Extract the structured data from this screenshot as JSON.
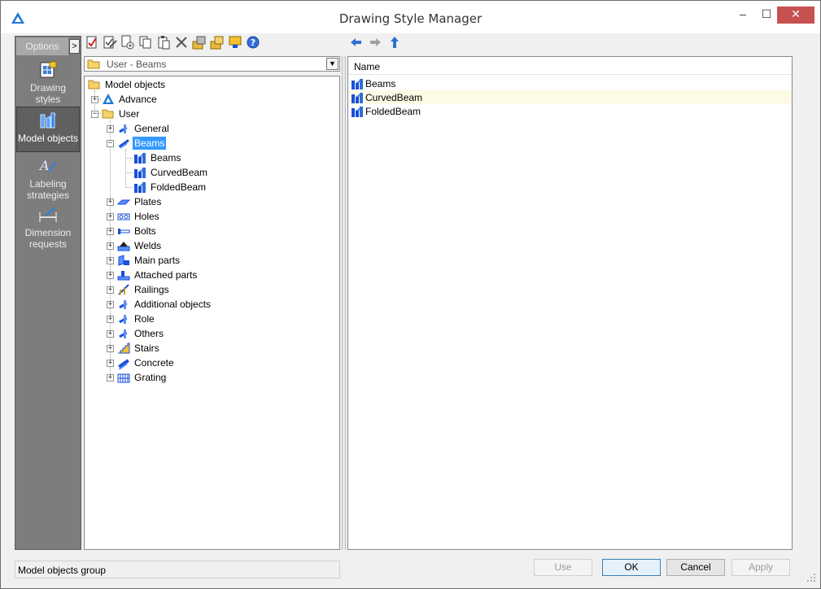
{
  "window": {
    "title": "Drawing Style Manager",
    "min_glyph": "–",
    "max_glyph": "☐",
    "close_glyph": "✕"
  },
  "sidebar": {
    "options_label": "Options",
    "collapse_glyph": ">",
    "items": [
      {
        "label": "Drawing styles",
        "icon": "drawing-styles-icon"
      },
      {
        "label": "Model objects",
        "icon": "model-objects-icon",
        "active": true
      },
      {
        "label": "Labeling strategies",
        "icon": "labeling-strategies-icon"
      },
      {
        "label": "Dimension requests",
        "icon": "dimension-requests-icon"
      }
    ]
  },
  "toolbar": {
    "icons": [
      "new-icon",
      "edit-icon",
      "new-from-icon",
      "copy-icon",
      "paste-icon",
      "delete-icon",
      "import-icon",
      "export-icon",
      "preview-icon",
      "help-icon"
    ]
  },
  "nav": {
    "icons": [
      "back-arrow-icon",
      "forward-arrow-icon",
      "up-arrow-icon"
    ]
  },
  "combo": {
    "value": "User - Beams"
  },
  "tree": {
    "root": "Model objects",
    "advance": "Advance",
    "user": "User",
    "user_children": [
      {
        "label": "General",
        "expanded": false
      },
      {
        "label": "Beams",
        "expanded": true,
        "selected": true
      },
      {
        "label": "Plates",
        "expanded": false
      },
      {
        "label": "Holes",
        "expanded": false
      },
      {
        "label": "Bolts",
        "expanded": false
      },
      {
        "label": "Welds",
        "expanded": false
      },
      {
        "label": "Main parts",
        "expanded": false
      },
      {
        "label": "Attached parts",
        "expanded": false
      },
      {
        "label": "Railings",
        "expanded": false
      },
      {
        "label": "Additional objects",
        "expanded": false
      },
      {
        "label": "Role",
        "expanded": false
      },
      {
        "label": "Others",
        "expanded": false
      },
      {
        "label": "Stairs",
        "expanded": false
      },
      {
        "label": "Concrete",
        "expanded": false
      },
      {
        "label": "Grating",
        "expanded": false
      }
    ],
    "beams_children": [
      "Beams",
      "CurvedBeam",
      "FoldedBeam"
    ]
  },
  "list": {
    "column_name": "Name",
    "rows": [
      "Beams",
      "CurvedBeam",
      "FoldedBeam"
    ]
  },
  "status": {
    "text": "Model objects group"
  },
  "buttons": {
    "use": "Use",
    "ok": "OK",
    "cancel": "Cancel",
    "apply": "Apply"
  },
  "colors": {
    "selection": "#3399ff",
    "sidebar_bg": "#7d7d7d",
    "close_button": "#c75050",
    "icon_blue": "#1a4fd8"
  }
}
